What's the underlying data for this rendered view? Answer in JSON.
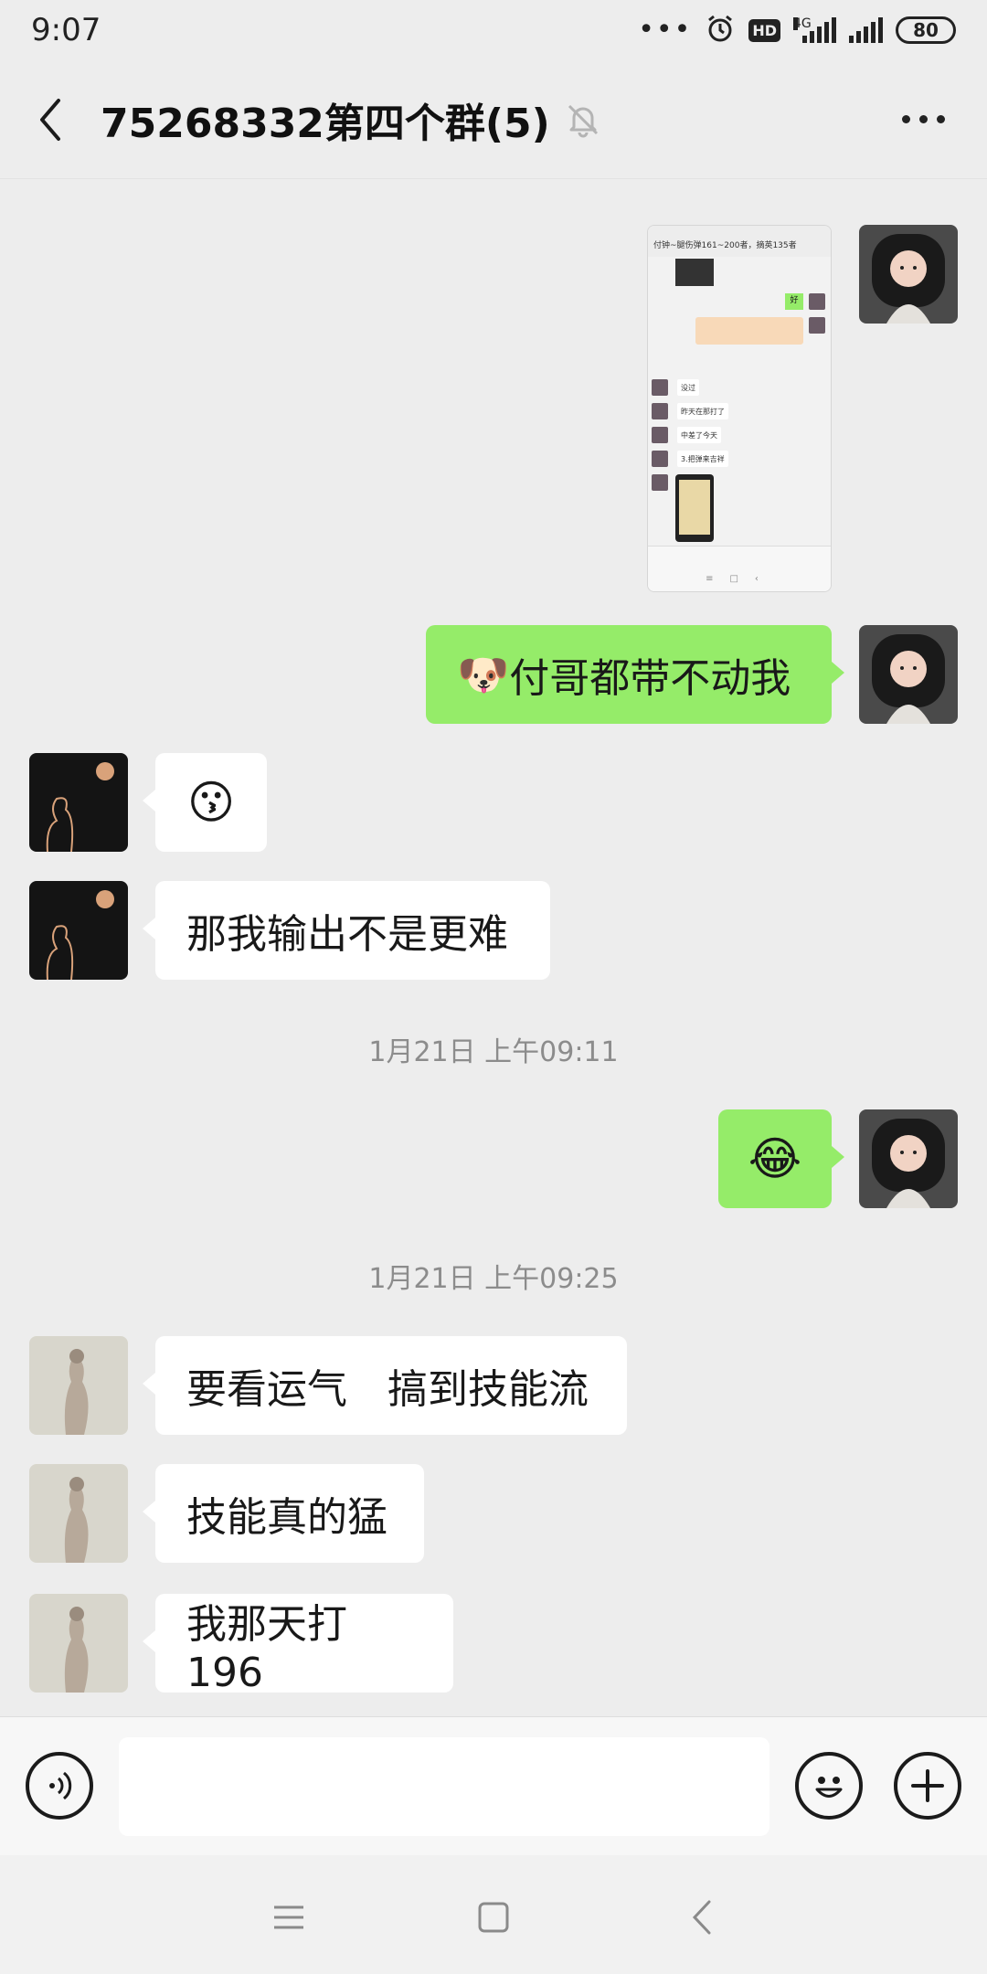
{
  "status_bar": {
    "time": "9:07",
    "more_dots": "•••",
    "hd": "HD",
    "network": "4G",
    "battery": "80"
  },
  "header": {
    "title": "75268332第四个群(5)",
    "back_icon": "chevron-left-icon",
    "mute_icon": "bell-off-icon",
    "more_icon": "more-dots-icon"
  },
  "thumbnail": {
    "top_text": "付钟~腿伤弹161~200者，摘英135者",
    "ok_text": "好",
    "rows": [
      "没过",
      "昨天在那打了",
      "中差了今天",
      "3.把弹来吉祥"
    ]
  },
  "messages": [
    {
      "side": "right",
      "type": "image",
      "desc_icon": "screenshot-image"
    },
    {
      "side": "right",
      "type": "text",
      "emoji": "🐶",
      "text": "付哥都带不动我"
    },
    {
      "side": "left",
      "type": "emoji",
      "text": "😗"
    },
    {
      "side": "left",
      "type": "text",
      "text": "那我输出不是更难"
    },
    {
      "type": "timestamp",
      "text": "1月21日 上午09:11"
    },
    {
      "side": "right",
      "type": "emoji",
      "text": "😂"
    },
    {
      "type": "timestamp",
      "text": "1月21日 上午09:25"
    },
    {
      "side": "left",
      "type": "text",
      "text": "要看运气　搞到技能流"
    },
    {
      "side": "left",
      "type": "text",
      "text": "技能真的猛"
    },
    {
      "side": "left",
      "type": "text",
      "text": "我那天打 196"
    }
  ],
  "input_bar": {
    "voice_icon": "voice-icon",
    "placeholder": "",
    "emoji_icon": "emoji-smile-icon",
    "plus_icon": "plus-icon"
  },
  "nav_bar": {
    "menu_icon": "menu-icon",
    "home_icon": "home-square-icon",
    "back_icon": "back-triangle-icon"
  }
}
